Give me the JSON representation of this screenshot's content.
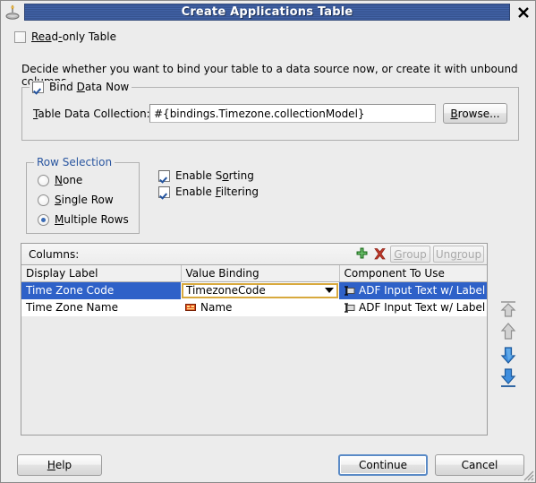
{
  "window": {
    "title": "Create Applications Table",
    "title_icon": "java-bean-icon",
    "close_icon": "close-icon"
  },
  "readonly": {
    "label": "Read-only Table",
    "checked": false
  },
  "instruction": "Decide whether you want to bind your table to a data source now, or create it with unbound columns.",
  "bind_group": {
    "title": "Bind Data Now",
    "checked": true,
    "field_label": "Table Data Collection:",
    "field_value": "#{bindings.Timezone.collectionModel}",
    "browse_label": "Browse..."
  },
  "row_selection": {
    "title": "Row Selection",
    "options": [
      {
        "label": "None",
        "selected": false
      },
      {
        "label": "Single Row",
        "selected": false
      },
      {
        "label": "Multiple Rows",
        "selected": true
      }
    ]
  },
  "options": [
    {
      "label": "Enable Sorting",
      "checked": true
    },
    {
      "label": "Enable Filtering",
      "checked": true
    }
  ],
  "columns_panel": {
    "label": "Columns:",
    "add_icon": "plus-icon",
    "delete_icon": "delete-x-icon",
    "group_label": "Group",
    "group_enabled": false,
    "ungroup_label": "Ungroup",
    "ungroup_enabled": false,
    "headers": [
      "Display Label",
      "Value Binding",
      "Component To Use"
    ],
    "rows": [
      {
        "display_label": "Time Zone Code",
        "value_binding": "TimezoneCode",
        "value_binding_editing": true,
        "component": "ADF Input Text w/ Label",
        "component_icon": "input-text-label-icon",
        "binding_icon": "attribute-icon",
        "selected": true
      },
      {
        "display_label": "Time Zone Name",
        "value_binding": "Name",
        "value_binding_editing": false,
        "component": "ADF Input Text w/ Label",
        "component_icon": "input-text-label-icon",
        "binding_icon": "attribute-icon",
        "selected": false
      }
    ]
  },
  "move_buttons": [
    {
      "name": "move-to-top-button",
      "icon": "arrow-to-top-icon",
      "enabled": false
    },
    {
      "name": "move-up-button",
      "icon": "arrow-up-icon",
      "enabled": false
    },
    {
      "name": "move-down-button",
      "icon": "arrow-down-icon",
      "enabled": true
    },
    {
      "name": "move-to-bottom-button",
      "icon": "arrow-to-bottom-icon",
      "enabled": true
    }
  ],
  "footer": {
    "help_label": "Help",
    "continue_label": "Continue",
    "cancel_label": "Cancel"
  },
  "colors": {
    "titlebar_blue": "#3b5ea5",
    "selection_blue": "#2e61c8",
    "group_title_blue": "#2a56a0",
    "editor_gold": "#d8a93e",
    "dialog_bg": "#ececec"
  }
}
